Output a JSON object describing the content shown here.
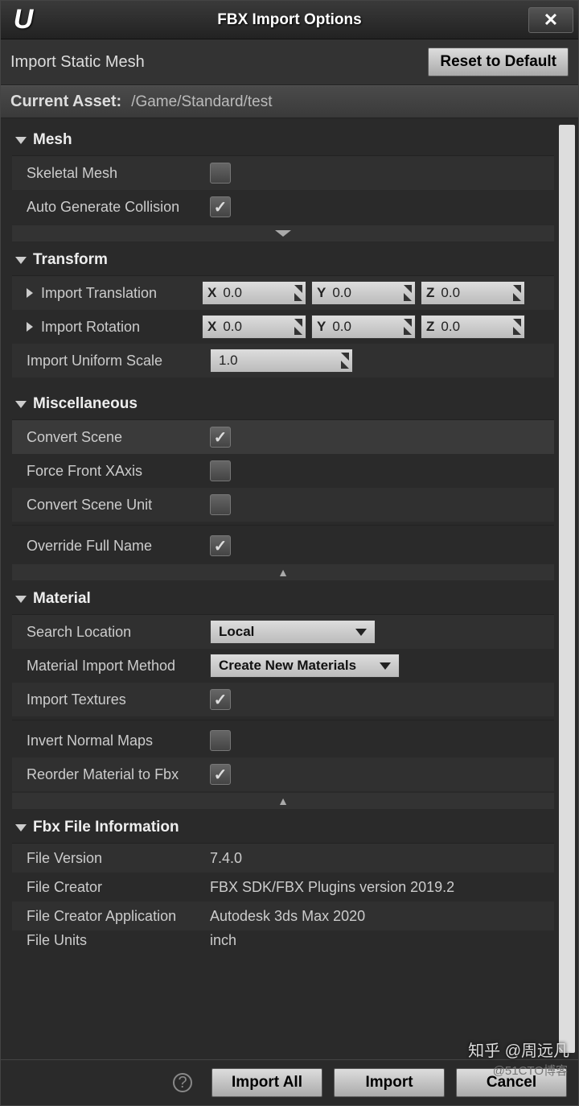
{
  "window": {
    "title": "FBX Import Options",
    "close": "✕"
  },
  "header": {
    "label": "Import Static Mesh",
    "reset": "Reset to Default"
  },
  "asset": {
    "label": "Current Asset:",
    "path": "/Game/Standard/test"
  },
  "sections": {
    "mesh": {
      "title": "Mesh",
      "skeletal_label": "Skeletal Mesh",
      "autocol_label": "Auto Generate Collision",
      "autocol_check": "✓"
    },
    "transform": {
      "title": "Transform",
      "trans_label": "Import Translation",
      "rot_label": "Import Rotation",
      "scale_label": "Import Uniform Scale",
      "x": "X",
      "y": "Y",
      "z": "Z",
      "tx": "0.0",
      "ty": "0.0",
      "tz": "0.0",
      "rx": "0.0",
      "ry": "0.0",
      "rz": "0.0",
      "scale": "1.0"
    },
    "misc": {
      "title": "Miscellaneous",
      "convert_label": "Convert Scene",
      "convert_check": "✓",
      "ffx_label": "Force Front XAxis",
      "csu_label": "Convert Scene Unit",
      "ofn_label": "Override Full Name",
      "ofn_check": "✓"
    },
    "material": {
      "title": "Material",
      "search_label": "Search Location",
      "search_val": "Local",
      "method_label": "Material Import Method",
      "method_val": "Create New Materials",
      "tex_label": "Import Textures",
      "tex_check": "✓",
      "inv_label": "Invert Normal Maps",
      "reorder_label": "Reorder Material to Fbx",
      "reorder_check": "✓"
    },
    "fileinfo": {
      "title": "Fbx File Information",
      "ver_label": "File Version",
      "ver_val": "7.4.0",
      "creator_label": "File Creator",
      "creator_val": "FBX SDK/FBX Plugins version 2019.2",
      "app_label": "File Creator Application",
      "app_val": "Autodesk 3ds Max 2020",
      "units_label": "File Units",
      "units_val": "inch"
    }
  },
  "footer": {
    "help": "?",
    "import_all": "Import All",
    "import": "Import",
    "cancel": "Cancel"
  },
  "watermark": {
    "t1": "知乎 @周远凡",
    "t2": "@51CTO博客"
  }
}
